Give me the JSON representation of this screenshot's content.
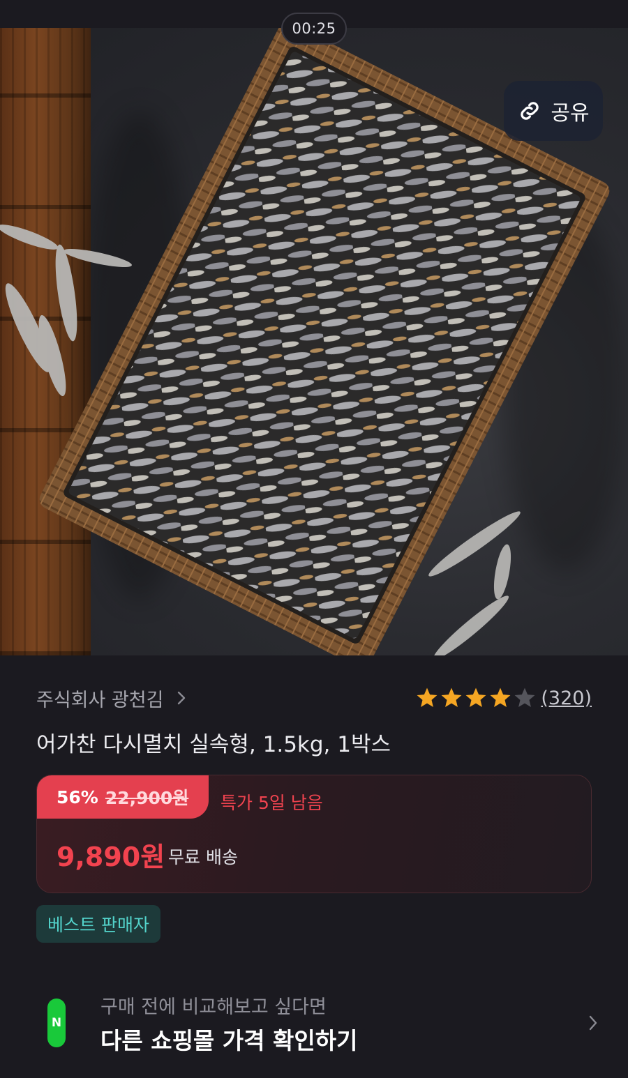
{
  "status_bar": {
    "timer": "00:25"
  },
  "hero": {
    "share_label": "공유",
    "share_icon": "link-icon"
  },
  "seller": {
    "name": "주식회사 광천김",
    "icon": "chevron-right-icon"
  },
  "rating": {
    "stars": 4,
    "max": 5,
    "count": "(320)",
    "star_color": "#f5a623",
    "empty_color": "#55555c"
  },
  "product": {
    "title": "어가찬 다시멸치 실속형, 1.5kg, 1박스"
  },
  "price": {
    "discount": "56%",
    "original": "22,900원",
    "deal_remaining": "특가 5일 남음",
    "sale_price": "9,890원",
    "shipping": "무료 배송",
    "accent_color": "#e4404f"
  },
  "badge": {
    "label": "베스트 판매자"
  },
  "compare": {
    "logo_letter": "N",
    "subtitle": "구매 전에 비교해보고 싶다면",
    "title": "다른 쇼핑몰 가격 확인하기"
  }
}
